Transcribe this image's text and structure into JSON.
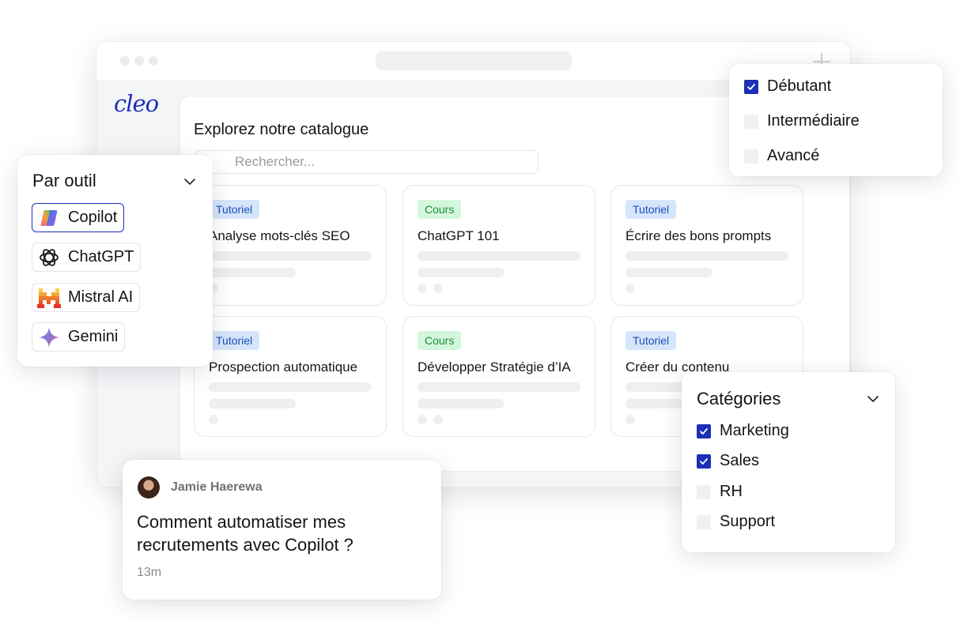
{
  "logo": "cleo",
  "catalog": {
    "title": "Explorez notre catalogue",
    "search_placeholder": "Rechercher...",
    "cards": [
      {
        "tag": "Tutoriel",
        "tag_type": "tutoriel",
        "title": "Analyse mots-clés SEO"
      },
      {
        "tag": "Cours",
        "tag_type": "cours",
        "title": "ChatGPT 101"
      },
      {
        "tag": "Tutoriel",
        "tag_type": "tutoriel",
        "title": "Écrire des bons prompts"
      },
      {
        "tag": "Tutoriel",
        "tag_type": "tutoriel",
        "title": "Prospection automatique"
      },
      {
        "tag": "Cours",
        "tag_type": "cours",
        "title": "Développer Stratégie d’IA"
      },
      {
        "tag": "Tutoriel",
        "tag_type": "tutoriel",
        "title": "Créer du contenu"
      }
    ]
  },
  "tools_filter": {
    "title": "Par outil",
    "items": [
      {
        "label": "Copilot",
        "icon": "copilot-icon",
        "selected": true
      },
      {
        "label": "ChatGPT",
        "icon": "chatgpt-icon",
        "selected": false
      },
      {
        "label": "Mistral AI",
        "icon": "mistral-icon",
        "selected": false
      },
      {
        "label": "Gemini",
        "icon": "gemini-icon",
        "selected": false
      }
    ]
  },
  "level_filter": {
    "items": [
      {
        "label": "Débutant",
        "checked": true
      },
      {
        "label": "Intermédiaire",
        "checked": false
      },
      {
        "label": "Avancé",
        "checked": false
      }
    ]
  },
  "categories_filter": {
    "title": "Catégories",
    "items": [
      {
        "label": "Marketing",
        "checked": true
      },
      {
        "label": "Sales",
        "checked": true
      },
      {
        "label": "RH",
        "checked": false
      },
      {
        "label": "Support",
        "checked": false
      }
    ]
  },
  "comment": {
    "author": "Jamie Haerewa",
    "question": "Comment automatiser mes recrutements avec Copilot ?",
    "time": "13m"
  },
  "colors": {
    "accent": "#1c2fb6",
    "tutoriel_bg": "#d5e6fb",
    "cours_bg": "#d4f7dc"
  }
}
